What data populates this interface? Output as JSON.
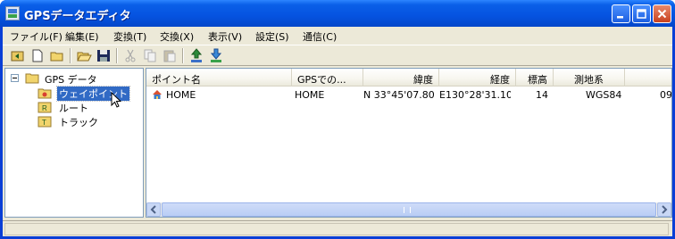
{
  "window": {
    "title": "GPSデータエディタ"
  },
  "menu": [
    {
      "label": "ファイル(F)"
    },
    {
      "label": "編集(E)"
    },
    {
      "label": "変換(T)"
    },
    {
      "label": "交換(X)"
    },
    {
      "label": "表示(V)"
    },
    {
      "label": "設定(S)"
    },
    {
      "label": "通信(C)"
    }
  ],
  "toolbar": {
    "icons": [
      "back-folder-icon",
      "new-file-icon",
      "new-folder-icon",
      "open-folder-icon",
      "save-icon",
      "cut-icon",
      "copy-icon",
      "paste-icon",
      "upload-icon",
      "download-icon"
    ]
  },
  "tree": {
    "root": {
      "label": "GPS データ",
      "expander": "⊟"
    },
    "children": [
      {
        "label": "ウェイポイント",
        "selected": true
      },
      {
        "label": "ルート"
      },
      {
        "label": "トラック"
      }
    ]
  },
  "list": {
    "columns": [
      "ポイント名",
      "GPSでの...",
      "緯度",
      "経度",
      "標高",
      "測地系",
      ""
    ],
    "rows": [
      {
        "name": "HOME",
        "gps_name": "HOME",
        "lat": "N 33°45'07.80\"",
        "lon": "E130°28'31.10\"",
        "alt": "14",
        "datum": "WGS84",
        "extra": "09"
      }
    ]
  },
  "scrollbar": {
    "left_arrow": "<",
    "right_arrow": ">",
    "grip": "III"
  },
  "status": {
    "text": ""
  }
}
